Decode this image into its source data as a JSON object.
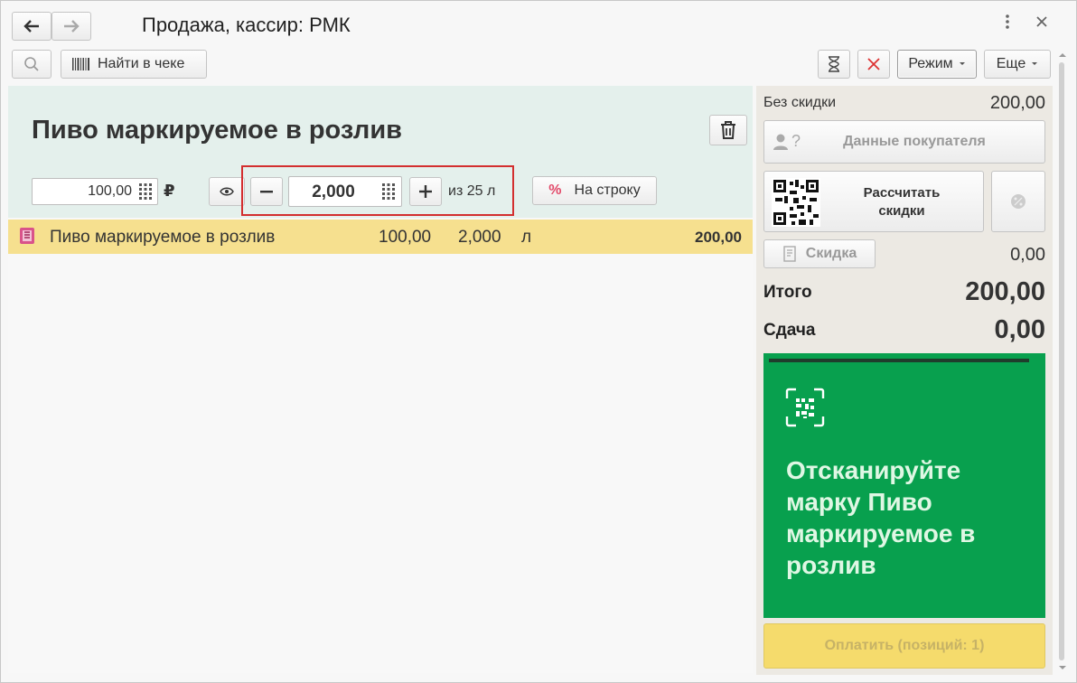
{
  "window": {
    "title": "Продажа, кассир: РМК"
  },
  "toolbar": {
    "find_in_receipt": "Найти в чеке",
    "mode": "Режим",
    "more": "Еще"
  },
  "product": {
    "name": "Пиво маркируемое в розлив",
    "price": "100,00",
    "currency": "₽",
    "quantity": "2,000",
    "of_total": "из 25 л",
    "per_line": "На строку",
    "percent_sign": "%"
  },
  "receipt": {
    "rows": [
      {
        "name": "Пиво маркируемое в розлив",
        "price": "100,00",
        "qty": "2,000",
        "unit": "л",
        "sum": "200,00"
      }
    ]
  },
  "summary": {
    "no_discount_label": "Без скидки",
    "no_discount_value": "200,00",
    "buyer_data": "Данные покупателя",
    "buyer_q": "?",
    "calc_discounts": "Рассчитать скидки",
    "discount_label": "Скидка",
    "discount_value": "0,00",
    "total_label": "Итого",
    "total_value": "200,00",
    "change_label": "Сдача",
    "change_value": "0,00"
  },
  "scan": {
    "message": "Отсканируйте марку Пиво маркируемое в розлив"
  },
  "pay": {
    "label": "Оплатить (позиций: 1)"
  },
  "colors": {
    "accent_green": "#08a04e",
    "highlight_row": "#f6e08f",
    "annotation_red": "#d32f2f"
  }
}
